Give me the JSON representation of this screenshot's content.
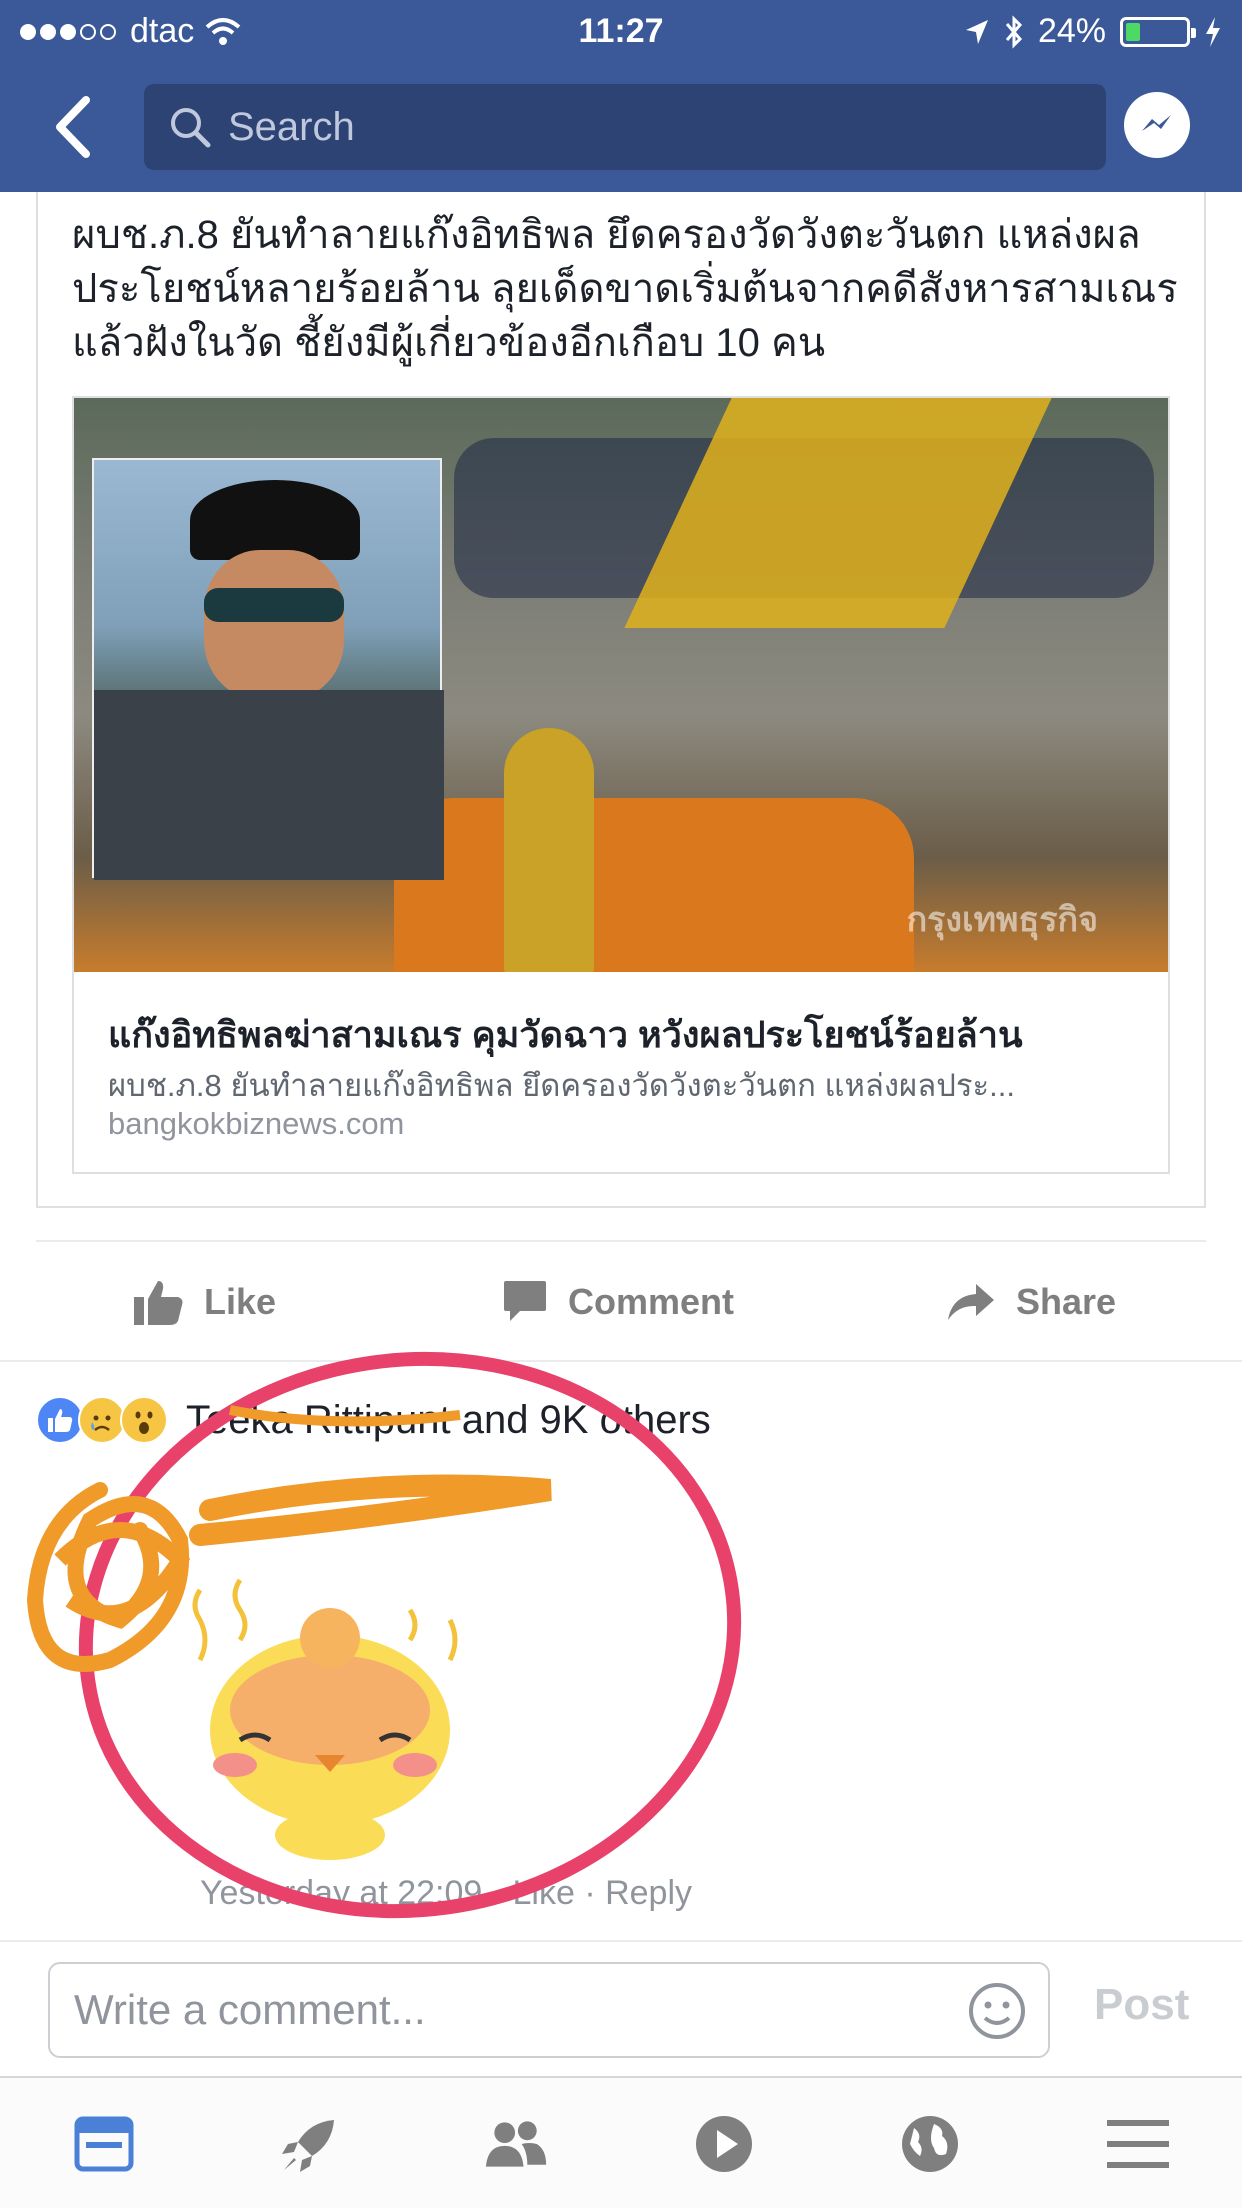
{
  "status_bar": {
    "carrier": "dtac",
    "time": "11:27",
    "battery": "24%",
    "battery_level": 0.24
  },
  "header": {
    "search_placeholder": "Search",
    "back_icon": "chevron-left-icon",
    "messenger_icon": "messenger-icon"
  },
  "post": {
    "text": "ผบช.ภ.8 ยันทำลายแก๊งอิทธิพล ยึดครองวัดวังตะวันตก แหล่งผลประโยชน์หลายร้อยล้าน ลุยเด็ดขาดเริ่มต้นจากคดีสังหารสามเณรแล้วฝังในวัด ชี้ยังมีผู้เกี่ยวข้องอีกเกือบ 10 คน",
    "link": {
      "image_watermark": "กรุงเทพธุรกิจ",
      "title": "แก๊งอิทธิพลฆ่าสามเณร คุมวัดฉาว หวังผลประโยชน์ร้อยล้าน",
      "description": "ผบช.ภ.8 ยันทำลายแก๊งอิทธิพล ยึดครองวัดวังตะวันตก แหล่งผลประ...",
      "domain": "bangkokbiznews.com"
    }
  },
  "actions": {
    "like": "Like",
    "comment": "Comment",
    "share": "Share"
  },
  "reactions": {
    "summary": "Teeka Rittipunt and 9K others",
    "types": [
      "like",
      "sad",
      "wow"
    ]
  },
  "comment": {
    "meta": "Yesterday at 22:09 · Like · Reply"
  },
  "composer": {
    "placeholder": "Write a comment...",
    "post_label": "Post"
  },
  "tabbar": {
    "items": [
      "news-feed-icon",
      "rocket-icon",
      "friends-icon",
      "video-icon",
      "globe-icon",
      "menu-icon"
    ]
  },
  "colors": {
    "brand": "#3b5998",
    "scribble_orange": "#f09a2a",
    "circle_pink": "#e8426b"
  }
}
